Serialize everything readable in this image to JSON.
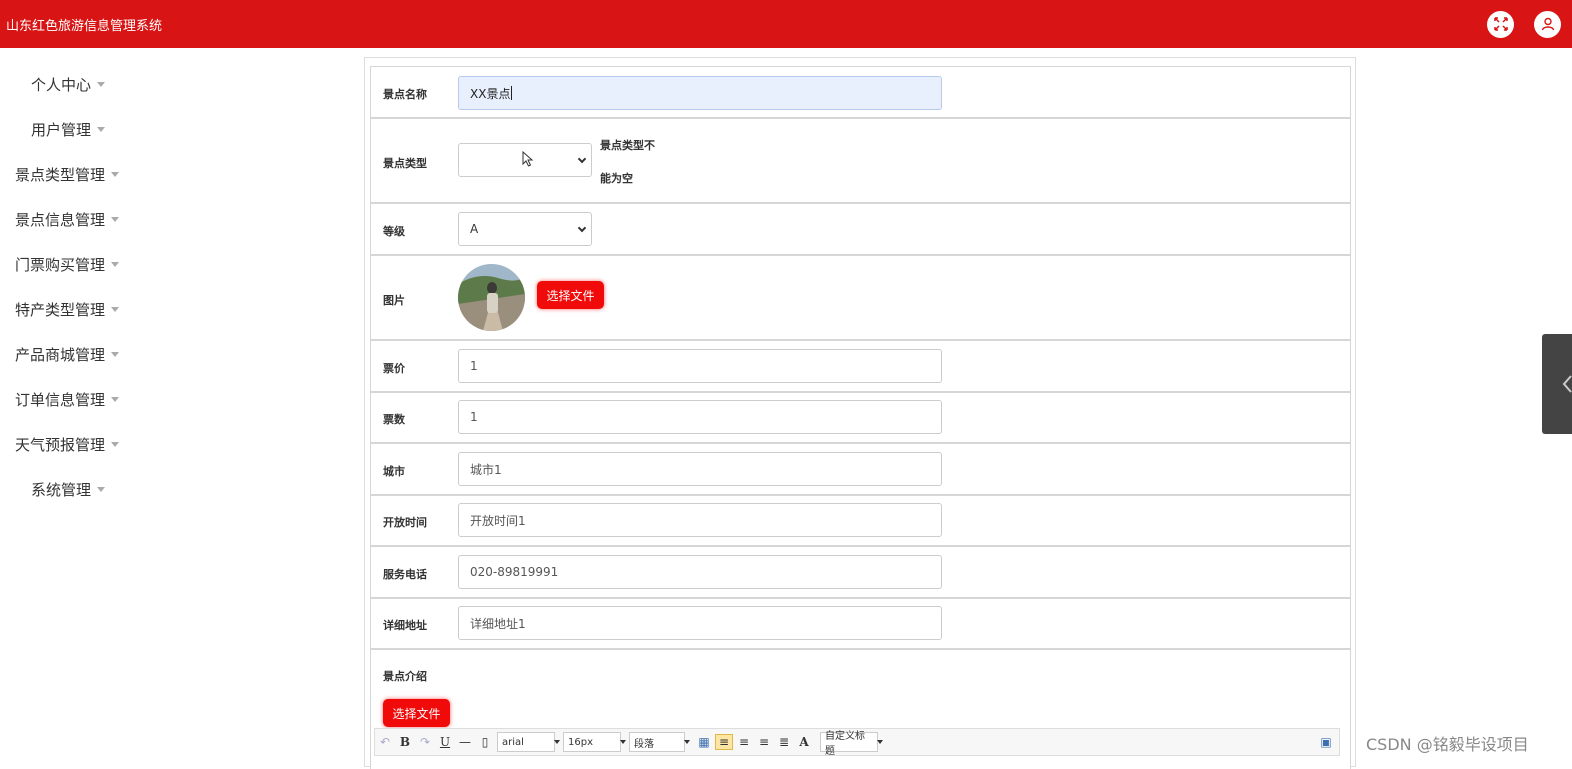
{
  "app": {
    "title": "山东红色旅游信息管理系统"
  },
  "header_icons": [
    "fullscreen-icon",
    "user-icon"
  ],
  "sidebar": {
    "items": [
      {
        "label": "个人中心"
      },
      {
        "label": "用户管理"
      },
      {
        "label": "景点类型管理"
      },
      {
        "label": "景点信息管理"
      },
      {
        "label": "门票购买管理"
      },
      {
        "label": "特产类型管理"
      },
      {
        "label": "产品商城管理"
      },
      {
        "label": "订单信息管理"
      },
      {
        "label": "天气预报管理"
      },
      {
        "label": "系统管理"
      }
    ]
  },
  "form": {
    "name": {
      "label": "景点名称",
      "value": "XX景点"
    },
    "type": {
      "label": "景点类型",
      "value": "",
      "error_line1": "景点类型不",
      "error_line2": "能为空"
    },
    "level": {
      "label": "等级",
      "value": "A"
    },
    "image": {
      "label": "图片",
      "button": "选择文件"
    },
    "price": {
      "label": "票价",
      "value": "1"
    },
    "count": {
      "label": "票数",
      "value": "1"
    },
    "city": {
      "label": "城市",
      "value": "城市1"
    },
    "open_time": {
      "label": "开放时间",
      "value": "开放时间1"
    },
    "phone": {
      "label": "服务电话",
      "value": "020-89819991"
    },
    "address": {
      "label": "详细地址",
      "value": "详细地址1"
    },
    "intro": {
      "label": "景点介绍",
      "button": "选择文件"
    }
  },
  "editor": {
    "font_family": "arial",
    "font_size": "16px",
    "paragraph": "段落",
    "custom_heading": "自定义标题",
    "buttons": [
      "undo-icon",
      "bold-icon",
      "redo-icon",
      "underline-icon",
      "horizontal-rule-icon",
      "page-icon",
      "table-icon",
      "align-left-icon",
      "align-right-icon",
      "align-center-icon",
      "align-justify-icon",
      "font-color-icon",
      "source-icon"
    ]
  },
  "watermark": "CSDN @铭毅毕设项目"
}
